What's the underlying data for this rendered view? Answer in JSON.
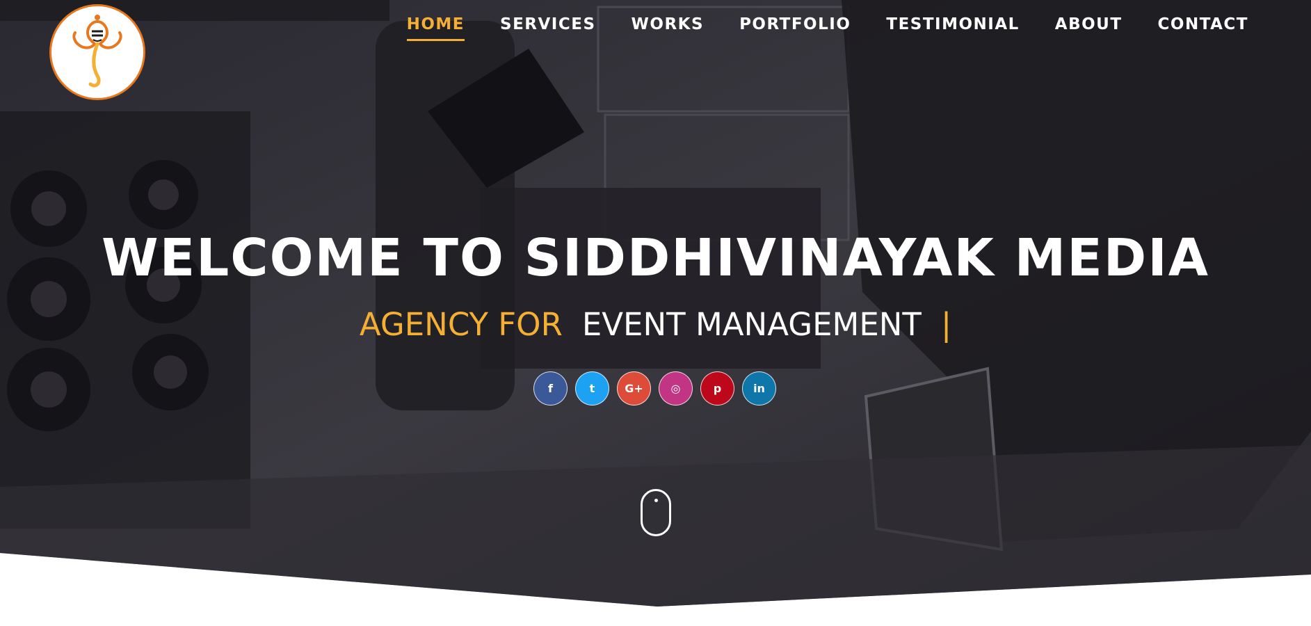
{
  "brand": {
    "logo_icon": "ganesha-logo-icon"
  },
  "nav": {
    "items": [
      {
        "label": "HOME",
        "active": true
      },
      {
        "label": "SERVICES",
        "active": false
      },
      {
        "label": "WORKS",
        "active": false
      },
      {
        "label": "PORTFOLIO",
        "active": false
      },
      {
        "label": "TESTIMONIAL",
        "active": false
      },
      {
        "label": "ABOUT",
        "active": false
      },
      {
        "label": "CONTACT",
        "active": false
      }
    ]
  },
  "hero": {
    "title": "WELCOME TO SIDDHIVINAYAK MEDIA",
    "tagline_prefix": "AGENCY FOR",
    "tagline_word": "EVENT MANAGEMENT",
    "tagline_cursor": "|"
  },
  "socials": [
    {
      "icon": "facebook-icon",
      "glyph": "f",
      "color": "#3b5998"
    },
    {
      "icon": "twitter-icon",
      "glyph": "t",
      "color": "#1da1f2"
    },
    {
      "icon": "google-plus-icon",
      "glyph": "G+",
      "color": "#dd4b39"
    },
    {
      "icon": "instagram-icon",
      "glyph": "◎",
      "color": "#c13584"
    },
    {
      "icon": "pinterest-icon",
      "glyph": "p",
      "color": "#bd081c"
    },
    {
      "icon": "linkedin-icon",
      "glyph": "in",
      "color": "#0e76a8"
    }
  ],
  "colors": {
    "accent": "#f5b034",
    "logo_orange": "#e8781e"
  },
  "scroll_indicator": {
    "icon": "mouse-scroll-icon"
  }
}
